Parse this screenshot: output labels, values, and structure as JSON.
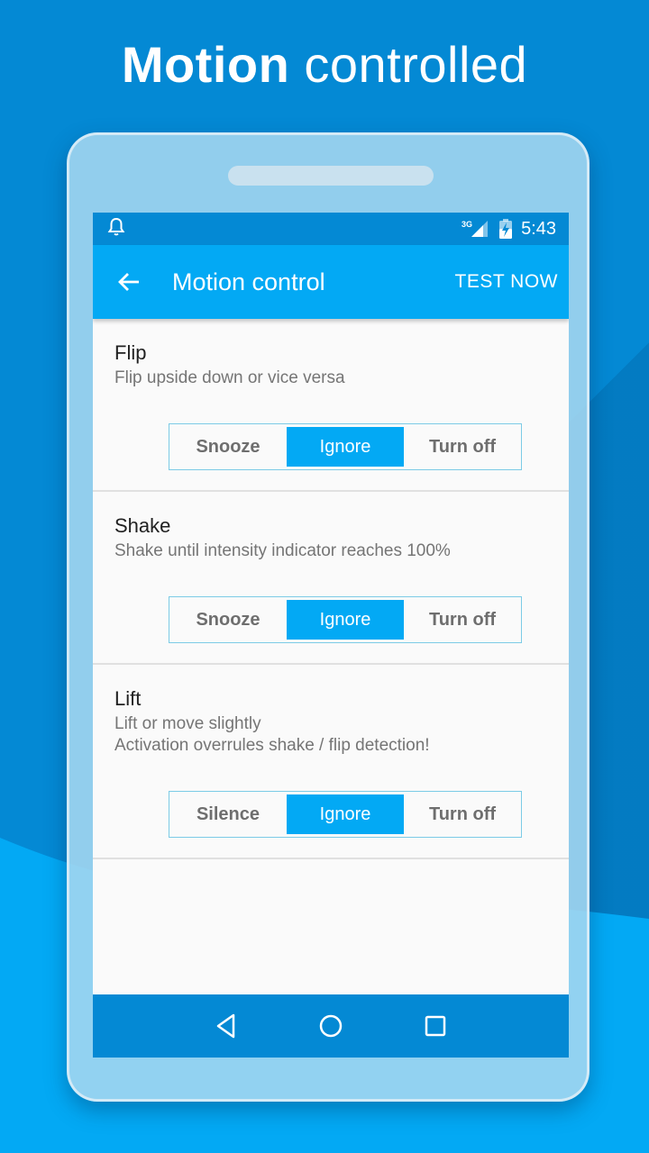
{
  "headline": {
    "bold": "Motion",
    "light": "controlled"
  },
  "statusbar": {
    "notification_icon": "bell-icon",
    "network_label": "3G",
    "signal_icon": "signal-icon",
    "battery_icon": "battery-charging-icon",
    "time": "5:43"
  },
  "appbar": {
    "back_icon": "arrow-left-icon",
    "title": "Motion control",
    "action": "TEST NOW"
  },
  "items": [
    {
      "name": "Flip",
      "description": [
        "Flip upside down or vice versa"
      ],
      "options": [
        "Snooze",
        "Ignore",
        "Turn off"
      ],
      "selected": "Ignore"
    },
    {
      "name": "Shake",
      "description": [
        "Shake until intensity indicator reaches 100%"
      ],
      "options": [
        "Snooze",
        "Ignore",
        "Turn off"
      ],
      "selected": "Ignore"
    },
    {
      "name": "Lift",
      "description": [
        "Lift or move slightly",
        "Activation overrules shake / flip detection!"
      ],
      "options": [
        "Silence",
        "Ignore",
        "Turn off"
      ],
      "selected": "Ignore"
    }
  ],
  "navbar": {
    "back": "nav-back-icon",
    "home": "nav-home-icon",
    "recents": "nav-recents-icon"
  },
  "colors": {
    "background": "#0489d4",
    "accent": "#03a9f4",
    "status_bar": "#0489d4",
    "wave": "#03a9f4"
  }
}
